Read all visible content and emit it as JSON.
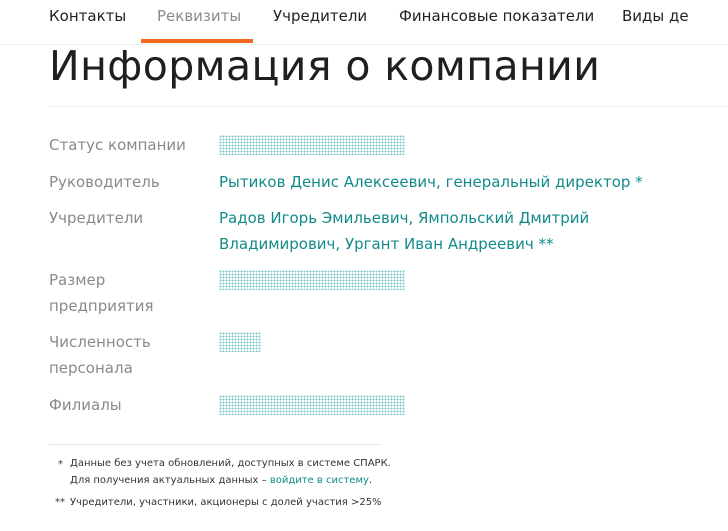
{
  "tabs": [
    {
      "label": "Контакты",
      "active": false
    },
    {
      "label": "Реквизиты",
      "active": true
    },
    {
      "label": "Учредители",
      "active": false
    },
    {
      "label": "Финансовые показатели",
      "active": false
    },
    {
      "label": "Виды де",
      "active": false
    }
  ],
  "accent_color": "#ef6a1a",
  "link_color": "#138a8a",
  "title": "Информация о компании",
  "fields": {
    "status": {
      "label": "Статус компании"
    },
    "head": {
      "label": "Руководитель",
      "value": "Рытиков Денис Алексеевич, генеральный директор",
      "mark": "*"
    },
    "founders": {
      "label": "Учредители",
      "line1": "Радов Игорь Эмильевич, Ямпольский Дмитрий",
      "line2": "Владимирович, Ургант Иван Андреевич",
      "mark": "**"
    },
    "size": {
      "label_line1": "Размер",
      "label_line2": "предприятия"
    },
    "staff": {
      "label_line1": "Численность",
      "label_line2": "персонала"
    },
    "branches": {
      "label": "Филиалы"
    }
  },
  "footnotes": {
    "note1_star": "*",
    "note1_line1": "Данные без учета обновлений, доступных в системе СПАРК.",
    "note1_line2_prefix": "Для получения актуальных данных –",
    "note1_link": "войдите в систему",
    "note1_suffix": ".",
    "note2_star": "**",
    "note2_text": "Учредители, участники, акционеры с долей участия >25%"
  }
}
